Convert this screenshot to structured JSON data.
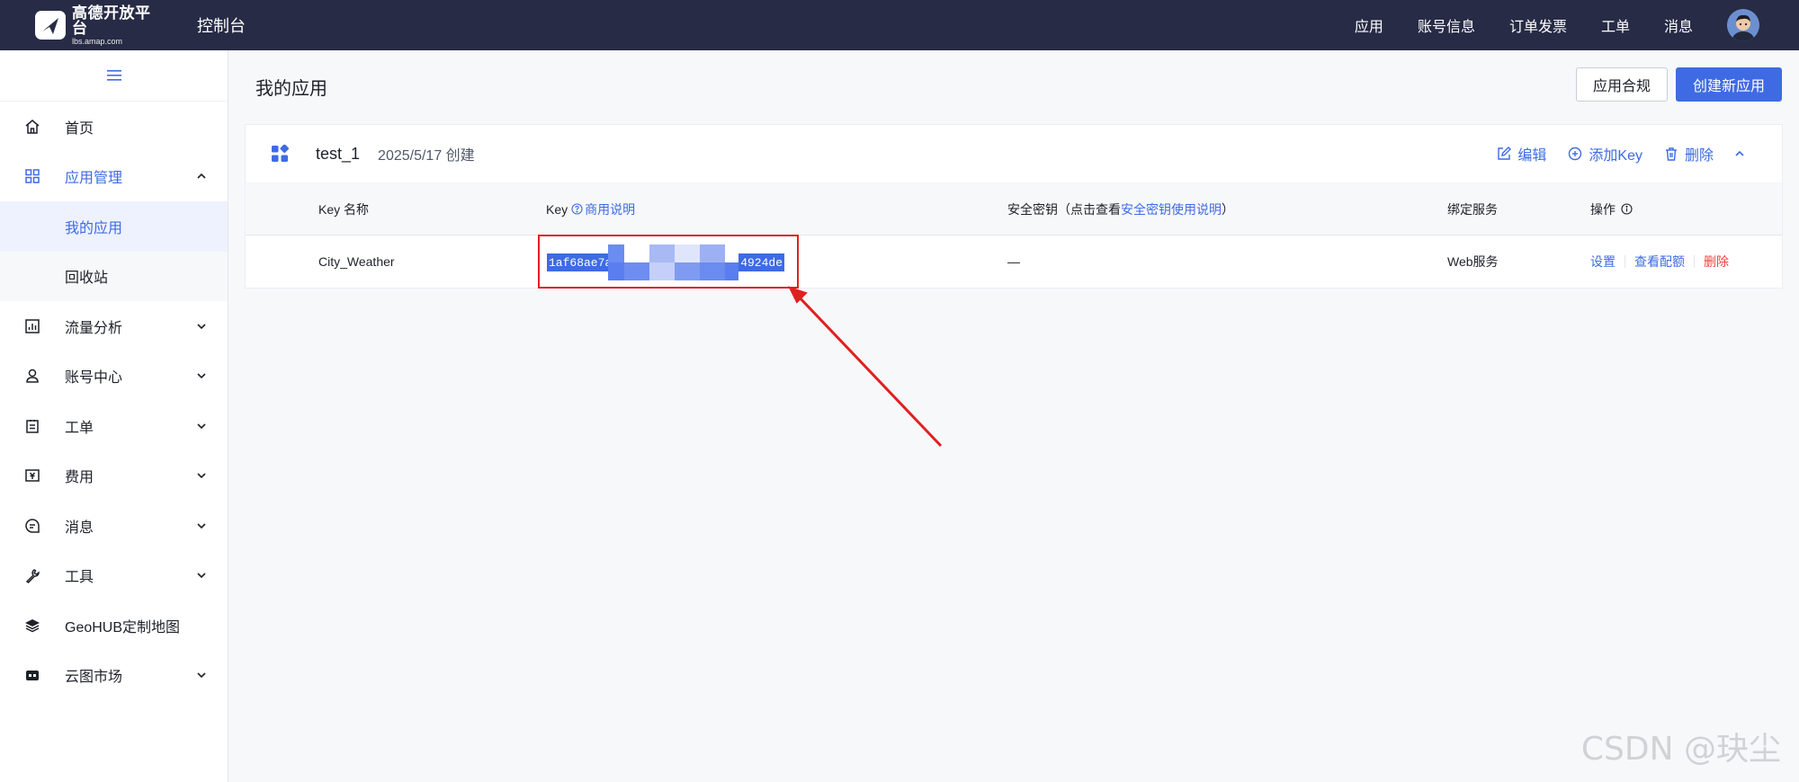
{
  "topbar": {
    "logo_cn": "高德开放平台",
    "logo_en": "lbs.amap.com",
    "console_title": "控制台",
    "nav": [
      "应用",
      "账号信息",
      "订单发票",
      "工单",
      "消息"
    ]
  },
  "sidebar": {
    "collapse_icon": "menu-icon",
    "items": [
      {
        "label": "首页",
        "icon": "home-icon"
      },
      {
        "label": "应用管理",
        "icon": "grid-icon",
        "expanded": true
      },
      {
        "label": "我的应用",
        "sub": true,
        "active": true
      },
      {
        "label": "回收站",
        "sub": true
      },
      {
        "label": "流量分析",
        "icon": "chart-icon"
      },
      {
        "label": "账号中心",
        "icon": "user-icon"
      },
      {
        "label": "工单",
        "icon": "ticket-icon"
      },
      {
        "label": "费用",
        "icon": "currency-icon"
      },
      {
        "label": "消息",
        "icon": "message-icon"
      },
      {
        "label": "工具",
        "icon": "wrench-icon"
      },
      {
        "label": "GeoHUB定制地图",
        "icon": "layers-icon"
      },
      {
        "label": "云图市场",
        "icon": "store-icon"
      }
    ]
  },
  "main": {
    "title": "我的应用",
    "compliance_button": "应用合规",
    "create_button": "创建新应用",
    "app": {
      "name": "test_1",
      "created": "2025/5/17 创建",
      "actions": {
        "edit": "编辑",
        "add_key": "添加Key",
        "delete": "删除"
      }
    },
    "table": {
      "headers": {
        "key_name": "Key 名称",
        "key": "Key",
        "key_help": "商用说明",
        "secret_prefix": "安全密钥（点击查看",
        "secret_link": "安全密钥使用说明",
        "secret_suffix": "）",
        "service": "绑定服务",
        "ops": "操作"
      },
      "rows": [
        {
          "key_name": "City_Weather",
          "key_start": "1af68ae7a",
          "key_end": "4924de",
          "secret": "—",
          "service": "Web服务",
          "ops": [
            "设置",
            "查看配额",
            "删除"
          ]
        }
      ]
    }
  },
  "colors": {
    "accent": "#3e6be4",
    "topbar": "#272b45",
    "annotation": "#e02020",
    "danger": "#f53f3f"
  },
  "watermark": "CSDN @玦尘"
}
